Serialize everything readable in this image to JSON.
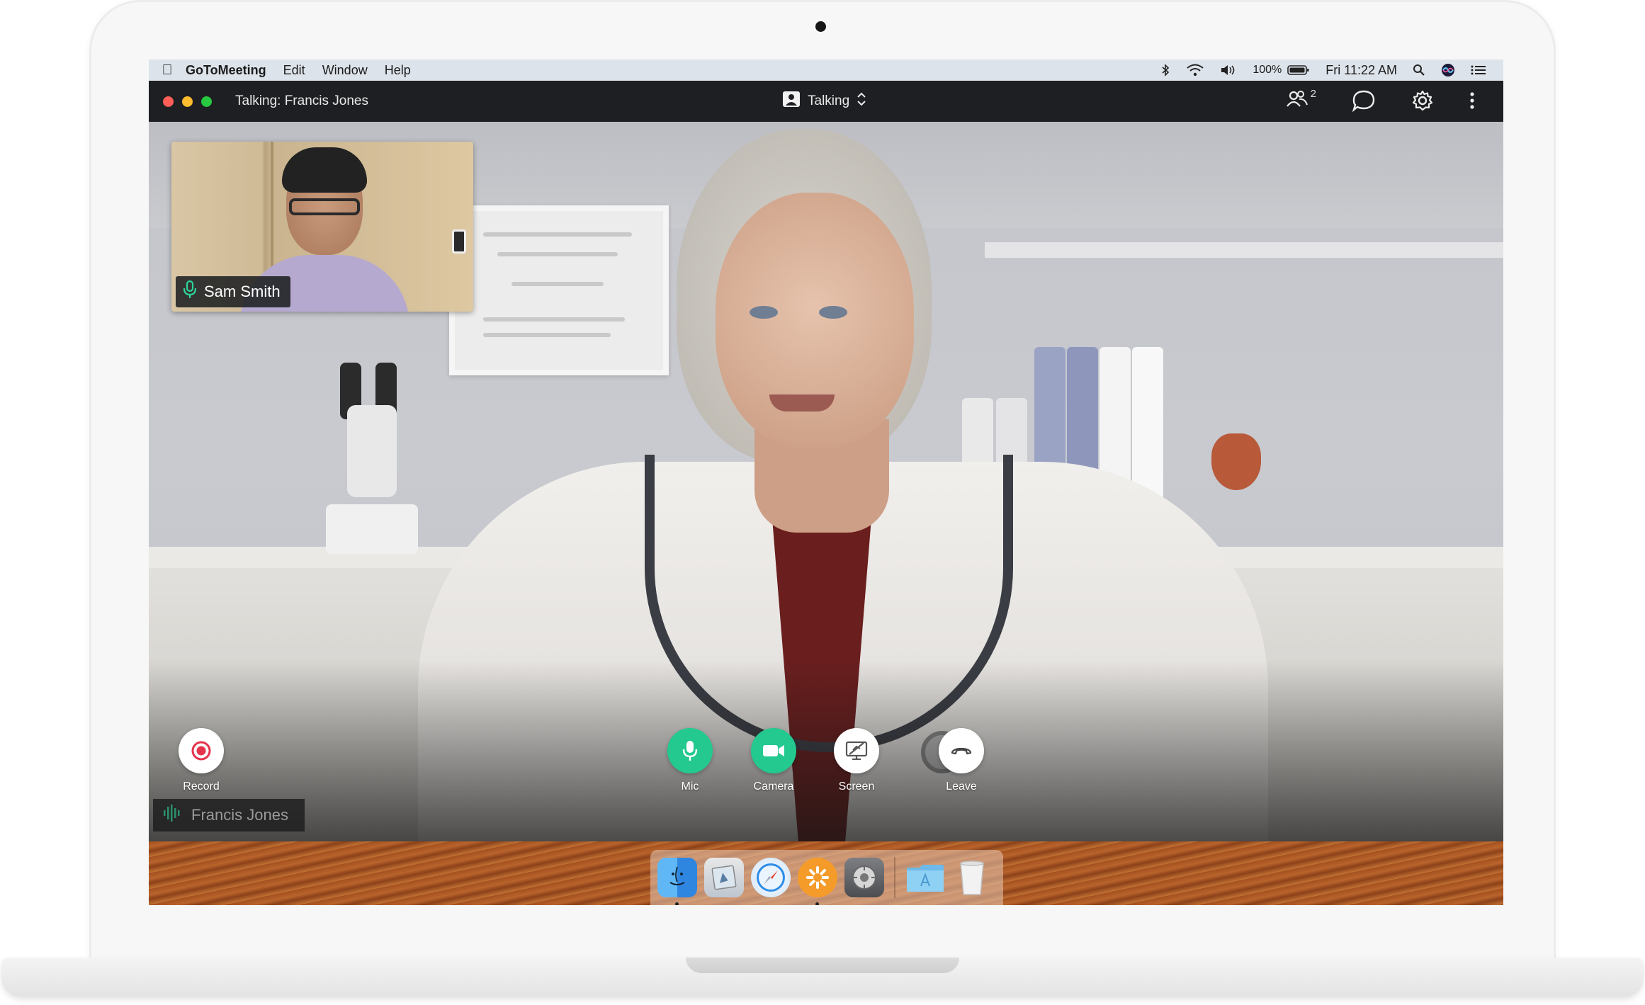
{
  "menubar": {
    "app_name": "GoToMeeting",
    "menus": [
      "Edit",
      "Window",
      "Help"
    ],
    "battery": "100%",
    "clock": "Fri 11:22 AM"
  },
  "titlebar": {
    "talking": "Talking: Francis Jones",
    "view_mode": "Talking",
    "participants_count": "2"
  },
  "self_view": {
    "name": "Sam Smith"
  },
  "controls": {
    "record": "Record",
    "mic": "Mic",
    "camera": "Camera",
    "screen": "Screen",
    "leave": "Leave"
  },
  "active_speaker": {
    "name": "Francis Jones"
  },
  "dock": {
    "apps": [
      "finder-icon",
      "preview-icon",
      "safari-icon",
      "gotomeeting-icon",
      "system-preferences-icon",
      "applications-folder-icon",
      "trash-icon"
    ]
  },
  "colors": {
    "accent_green": "#24c98f",
    "record_red": "#e5334b",
    "titlebar_bg": "#1d1f22"
  }
}
